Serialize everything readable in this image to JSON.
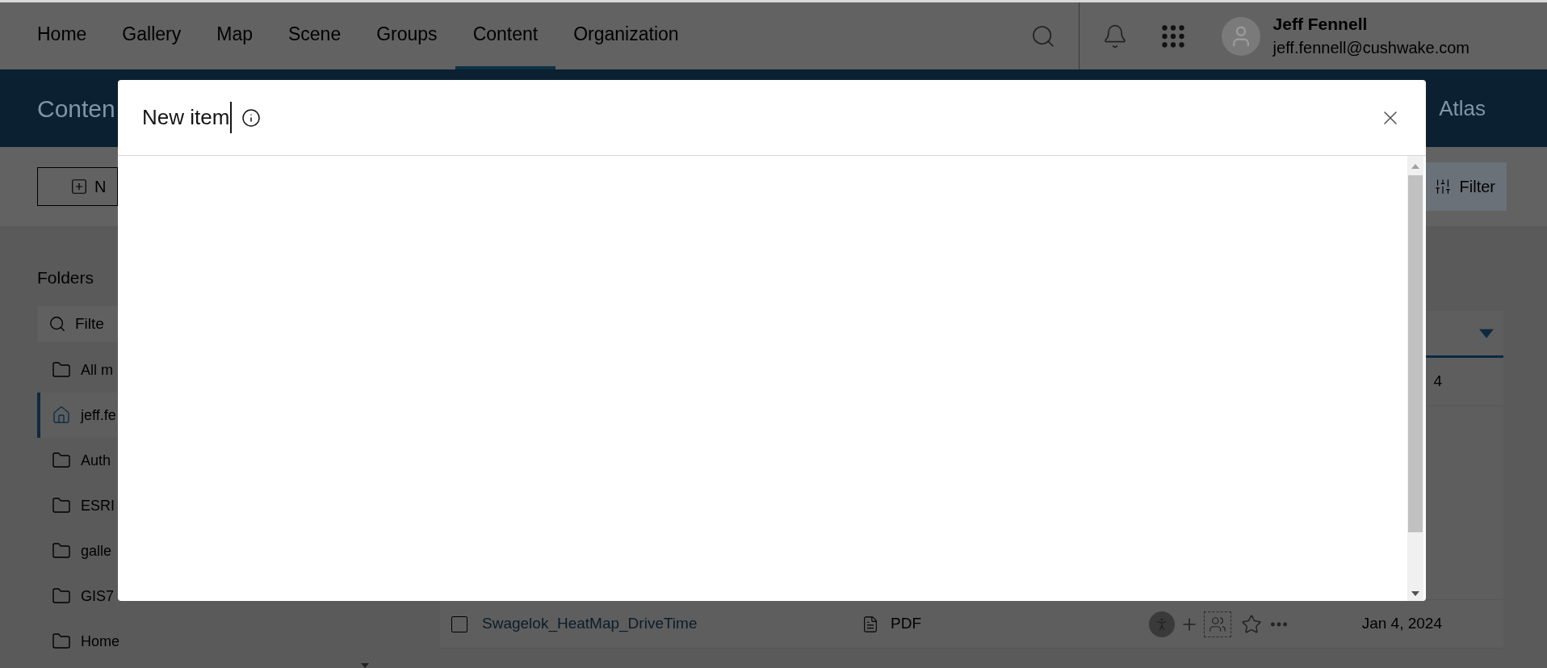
{
  "nav": {
    "tabs": [
      {
        "label": "Home",
        "selected": false
      },
      {
        "label": "Gallery",
        "selected": false
      },
      {
        "label": "Map",
        "selected": false
      },
      {
        "label": "Scene",
        "selected": false
      },
      {
        "label": "Groups",
        "selected": false
      },
      {
        "label": "Content",
        "selected": true
      },
      {
        "label": "Organization",
        "selected": false
      }
    ],
    "user": {
      "name": "Jeff Fennell",
      "email": "jeff.fennell@cushwake.com"
    }
  },
  "banner": {
    "title": "Conten",
    "right_text": "Atlas"
  },
  "toolbar": {
    "new_button": "N",
    "filter_button": "Filter"
  },
  "sidebar": {
    "heading": "Folders",
    "filter_placeholder": "Filte",
    "folders": [
      {
        "label": "All m",
        "kind": "folder",
        "selected": false
      },
      {
        "label": "jeff.fe",
        "kind": "home",
        "selected": true
      },
      {
        "label": "Auth",
        "kind": "folder",
        "selected": false
      },
      {
        "label": "ESRI",
        "kind": "folder",
        "selected": false
      },
      {
        "label": "galle",
        "kind": "folder",
        "selected": false
      },
      {
        "label": "GIS7",
        "kind": "folder",
        "selected": false
      },
      {
        "label": "Home",
        "kind": "folder",
        "selected": false
      }
    ]
  },
  "table": {
    "rows": [
      {
        "date": "4"
      },
      {
        "title": "Swagelok_HeatMap_DriveTime",
        "type": "PDF",
        "date": "Jan 4, 2024",
        "checked": false
      }
    ]
  },
  "modal": {
    "title": "New item"
  }
}
